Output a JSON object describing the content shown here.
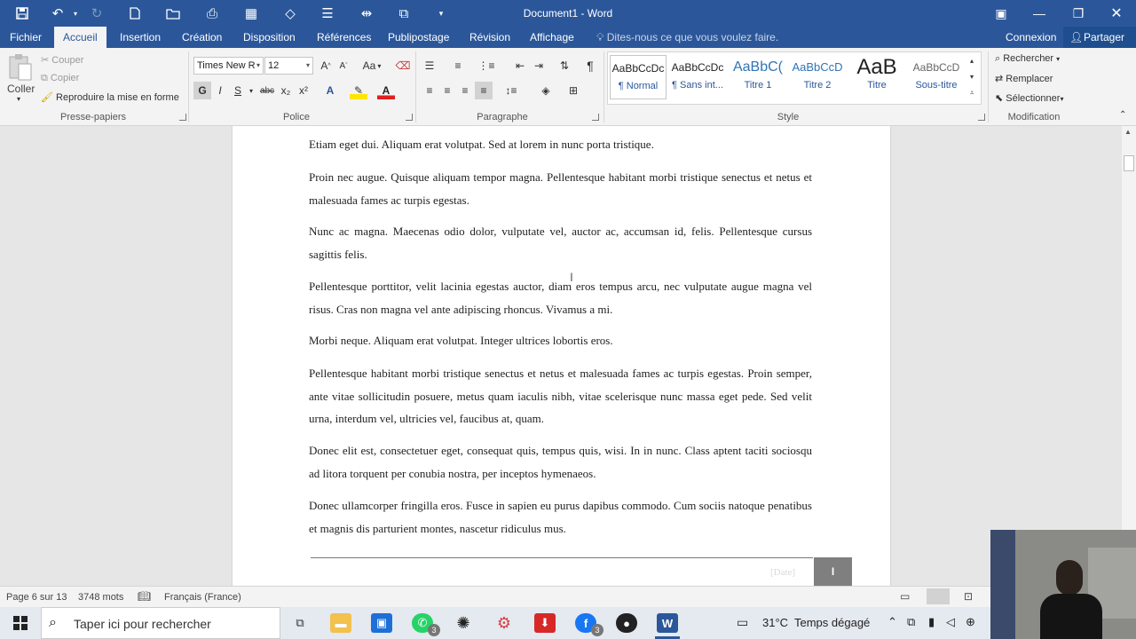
{
  "titlebar": {
    "document_title": "Document1 - Word"
  },
  "tabs": [
    {
      "label": "Fichier"
    },
    {
      "label": "Accueil"
    },
    {
      "label": "Insertion"
    },
    {
      "label": "Création"
    },
    {
      "label": "Disposition"
    },
    {
      "label": "Références"
    },
    {
      "label": "Publipostage"
    },
    {
      "label": "Révision"
    },
    {
      "label": "Affichage"
    }
  ],
  "tell_me": "Dites-nous ce que vous voulez faire.",
  "account": {
    "signin": "Connexion",
    "share": "Partager"
  },
  "clipboard": {
    "paste": "Coller",
    "cut": "Couper",
    "copy": "Copier",
    "format_painter": "Reproduire la mise en forme",
    "label": "Presse-papiers"
  },
  "font": {
    "name": "Times New R",
    "size": "12",
    "bold": "G",
    "italic": "I",
    "underline": "S",
    "strike": "abc",
    "sub": "x₂",
    "sup": "x²",
    "aa": "Aa",
    "label": "Police"
  },
  "paragraph": {
    "label": "Paragraphe",
    "pilcrow": "¶"
  },
  "styles": {
    "label": "Style",
    "items": [
      {
        "preview": "AaBbCcDc",
        "name": "¶ Normal"
      },
      {
        "preview": "AaBbCcDc",
        "name": "¶ Sans int..."
      },
      {
        "preview": "AaBbC(",
        "name": "Titre 1"
      },
      {
        "preview": "AaBbCcD",
        "name": "Titre 2"
      },
      {
        "preview": "AaB",
        "name": "Titre"
      },
      {
        "preview": "AaBbCcD",
        "name": "Sous-titre"
      }
    ]
  },
  "editing": {
    "find": "Rechercher",
    "replace": "Remplacer",
    "select": "Sélectionner",
    "label": "Modification"
  },
  "document": {
    "paragraphs": [
      "Etiam eget dui. Aliquam erat volutpat. Sed at lorem in nunc porta tristique.",
      "Proin nec augue. Quisque aliquam tempor magna. Pellentesque habitant morbi tristique senectus et netus et malesuada fames ac turpis egestas.",
      "Nunc ac magna. Maecenas odio dolor, vulputate vel, auctor ac, accumsan id, felis. Pellentesque cursus sagittis felis.",
      "Pellentesque porttitor, velit lacinia egestas auctor, diam eros tempus arcu, nec vulputate augue magna vel risus. Cras non magna vel ante adipiscing rhoncus. Vivamus a mi.",
      "Morbi neque. Aliquam erat volutpat. Integer ultrices lobortis eros.",
      "Pellentesque habitant morbi tristique senectus et netus et malesuada fames ac turpis egestas. Proin semper, ante vitae sollicitudin posuere, metus quam iaculis nibh, vitae scelerisque nunc massa eget pede. Sed velit urna, interdum vel, ultricies vel, faucibus at, quam.",
      "Donec elit est, consectetuer eget, consequat quis, tempus quis, wisi. In in nunc. Class aptent taciti sociosqu ad litora torquent per conubia nostra, per inceptos hymenaeos.",
      "Donec ullamcorper fringilla eros. Fusce in sapien eu purus dapibus commodo. Cum sociis natoque penatibus et magnis dis parturient montes, nascetur ridiculus mus."
    ],
    "footer_date": "[Date]",
    "page_number": "I"
  },
  "status": {
    "page": "Page 6 sur 13",
    "words": "3748 mots",
    "language": "Français (France)"
  },
  "taskbar": {
    "search_placeholder": "Taper ici pour rechercher",
    "weather_temp": "31°C",
    "weather_desc": "Temps dégagé",
    "badge_whatsapp": "3",
    "badge_facebook": "3"
  },
  "colors": {
    "word_blue": "#2b579a",
    "ribbon_bg": "#f3f3f3",
    "taskbar_bg": "#e5e9f0"
  }
}
